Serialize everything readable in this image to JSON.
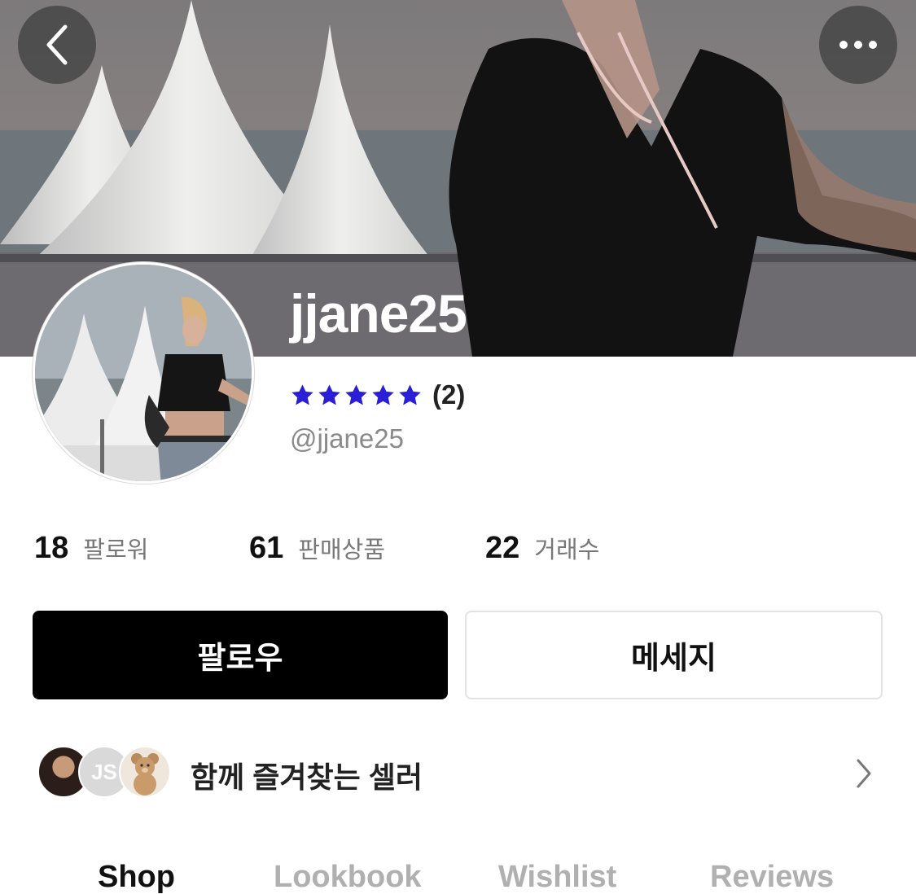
{
  "header": {
    "back_icon": "chevron-left-icon",
    "more_icon": "more-horizontal-icon"
  },
  "profile": {
    "username": "jjane25",
    "handle": "@jjane25",
    "rating_stars": 5,
    "rating_count": "(2)",
    "star_color": "#2a1fd6"
  },
  "stats": [
    {
      "number": "18",
      "label": "팔로워"
    },
    {
      "number": "61",
      "label": "판매상품"
    },
    {
      "number": "22",
      "label": "거래수"
    }
  ],
  "actions": {
    "follow_label": "팔로우",
    "message_label": "메세지"
  },
  "favorite_sellers": {
    "label": "함께 즐겨찾는 셀러",
    "avatar_2_text": "JS"
  },
  "tabs": [
    {
      "label": "Shop",
      "active": true
    },
    {
      "label": "Lookbook",
      "active": false
    },
    {
      "label": "Wishlist",
      "active": false
    },
    {
      "label": "Reviews",
      "active": false
    }
  ]
}
